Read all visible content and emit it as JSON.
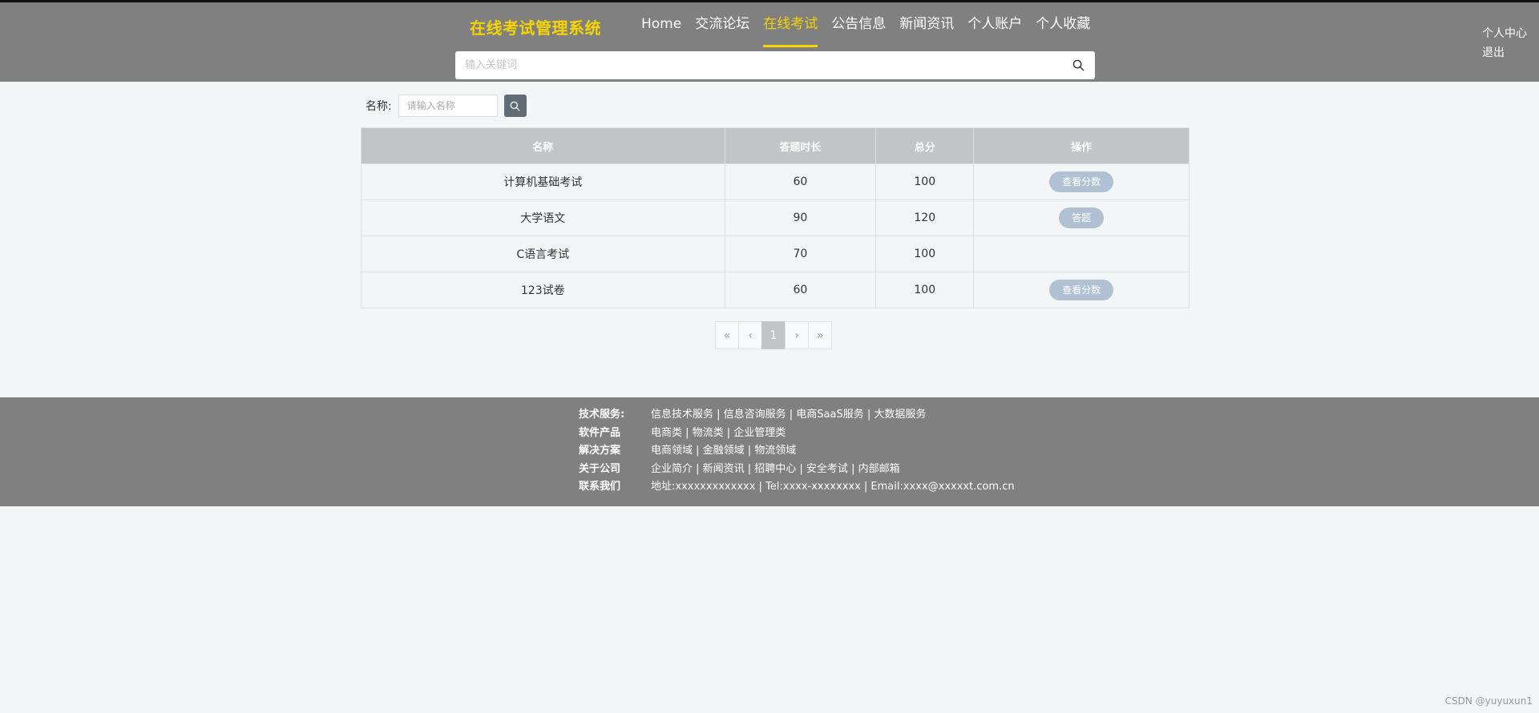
{
  "header": {
    "site_title": "在线考试管理系统",
    "nav": [
      {
        "label": "Home",
        "active": false
      },
      {
        "label": "交流论坛",
        "active": false
      },
      {
        "label": "在线考试",
        "active": true
      },
      {
        "label": "公告信息",
        "active": false
      },
      {
        "label": "新闻资讯",
        "active": false
      },
      {
        "label": "个人账户",
        "active": false
      },
      {
        "label": "个人收藏",
        "active": false
      }
    ],
    "user_links": [
      "个人中心",
      "退出"
    ],
    "search_placeholder": "输入关键词",
    "search_icon": "search-icon"
  },
  "filter": {
    "label": "名称:",
    "placeholder": "请输入名称",
    "button_icon": "search-icon"
  },
  "table": {
    "columns": [
      "名称",
      "答题时长",
      "总分",
      "操作"
    ],
    "rows": [
      {
        "name": "计算机基础考试",
        "duration": "60",
        "score": "100",
        "action": "查看分数"
      },
      {
        "name": "大学语文",
        "duration": "90",
        "score": "120",
        "action": "答题"
      },
      {
        "name": "C语言考试",
        "duration": "70",
        "score": "100",
        "action": ""
      },
      {
        "name": "123试卷",
        "duration": "60",
        "score": "100",
        "action": "查看分数"
      }
    ]
  },
  "pagination": {
    "first": "«",
    "prev": "‹",
    "current": "1",
    "next": "›",
    "last": "»"
  },
  "footer": {
    "rows": [
      {
        "key": "技术服务:",
        "value": "信息技术服务 | 信息咨询服务 | 电商SaaS服务 | 大数据服务"
      },
      {
        "key": "软件产品",
        "value": "电商类 | 物流类 | 企业管理类"
      },
      {
        "key": "解决方案",
        "value": "电商领域 | 金融领域 | 物流领域"
      },
      {
        "key": "关于公司",
        "value": "企业简介 | 新闻资讯 | 招聘中心 | 安全考试 | 内部邮箱"
      },
      {
        "key": "联系我们",
        "value": "地址:xxxxxxxxxxxxx | Tel:xxxx-xxxxxxxx | Email:xxxx@xxxxxt.com.cn"
      }
    ]
  },
  "watermark": "CSDN @yuyuxun1",
  "colors": {
    "header_bg": "#808080",
    "accent": "#f5d400",
    "table_header_bg": "#c1c5c6",
    "op_button_bg": "#b1c1d4"
  }
}
